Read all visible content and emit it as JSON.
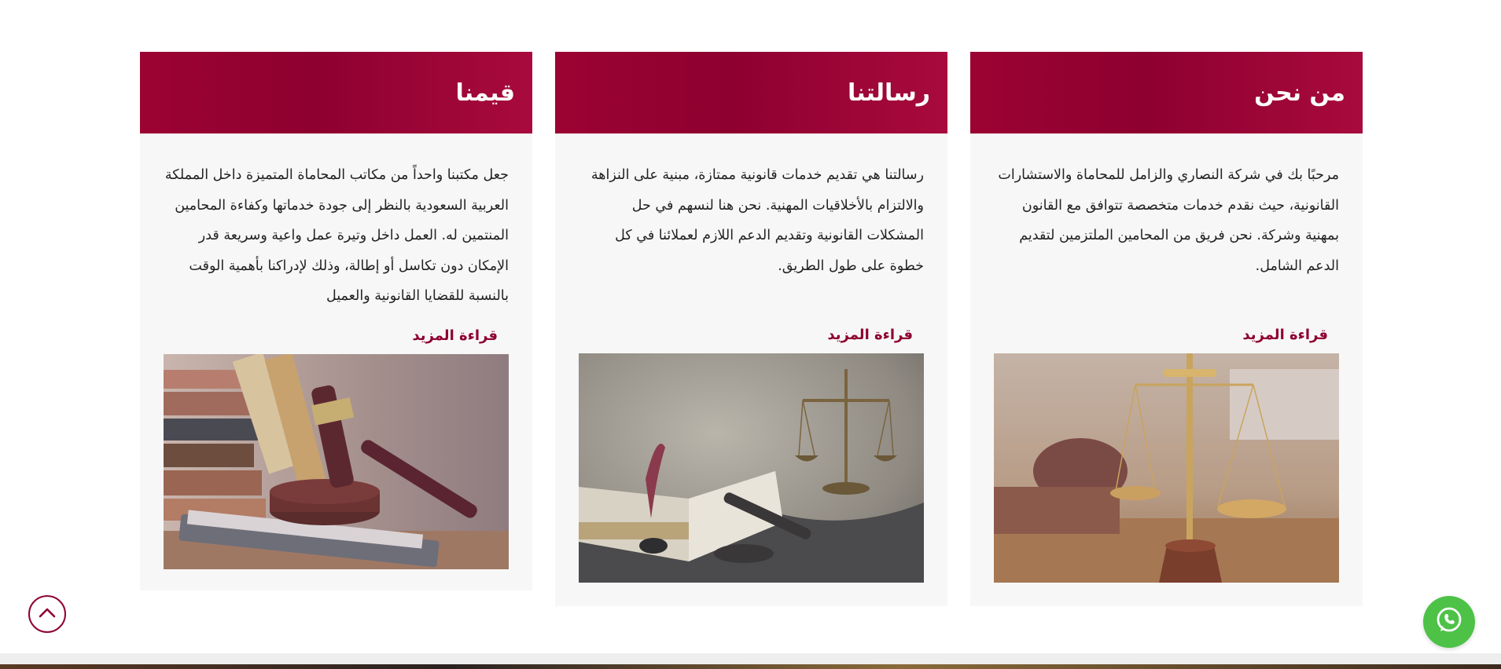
{
  "colors": {
    "brand": "#8e0030",
    "card_background": "#f7f7f7",
    "whatsapp_green": "#4dc247"
  },
  "cards": [
    {
      "title": "من نحن",
      "text": "مرحبًا بك في شركة النصاري والزامل للمحاماة والاستشارات القانونية، حيث نقدم خدمات متخصصة تتوافق مع القانون بمهنية وشركة. نحن فريق من المحامين الملتزمين لتقديم الدعم الشامل.",
      "read_more": "قراءة المزيد",
      "image": "scales-of-justice-photo"
    },
    {
      "title": "رسالتنا",
      "text": "رسالتنا هي تقديم خدمات قانونية ممتازة، مبنية على النزاهة والالتزام بالأخلاقيات المهنية. نحن هنا لنسهم في حل المشكلات القانونية وتقديم الدعم اللازم لعملائنا في كل خطوة على طول الطريق.",
      "read_more": "قراءة المزيد",
      "image": "law-book-scales-photo"
    },
    {
      "title": "قيمنا",
      "text": "جعل مكتبنا واحداً من مكاتب المحاماة المتميزة داخل المملكة العربية السعودية بالنظر إلى جودة خدماتها وكفاءة المحامين المنتمين له. العمل داخل وتيرة عمل واعية وسريعة قدر الإمكان دون تكاسل أو إطالة، وذلك لإدراكنا بأهمية الوقت بالنسبة للقضايا القانونية والعميل",
      "read_more": "قراءة المزيد",
      "image": "gavel-books-photo"
    }
  ],
  "floating": {
    "scroll_top_icon": "chevron-up-icon",
    "whatsapp_icon": "whatsapp-icon"
  }
}
